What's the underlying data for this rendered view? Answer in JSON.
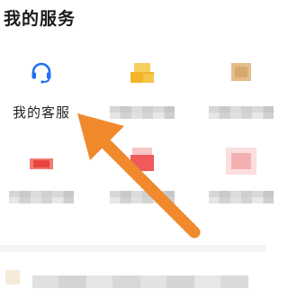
{
  "section": {
    "title": "我的服务"
  },
  "services": [
    {
      "label": "我的客服",
      "icon": "headset-icon",
      "icon_color": "#1f6ff0"
    },
    {
      "label": "",
      "icon": "pixelated-icon",
      "icon_color": "#f2b52a"
    },
    {
      "label": "",
      "icon": "pixelated-icon",
      "icon_color": "#e0b98a"
    },
    {
      "label": "",
      "icon": "pixelated-icon",
      "icon_color": "#e8443c"
    },
    {
      "label": "",
      "icon": "pixelated-icon",
      "icon_color": "#ef5a5a"
    },
    {
      "label": "",
      "icon": "pixelated-icon",
      "icon_color": "#f4b0b0"
    }
  ],
  "annotation": {
    "arrow_color": "#f08a2c"
  }
}
